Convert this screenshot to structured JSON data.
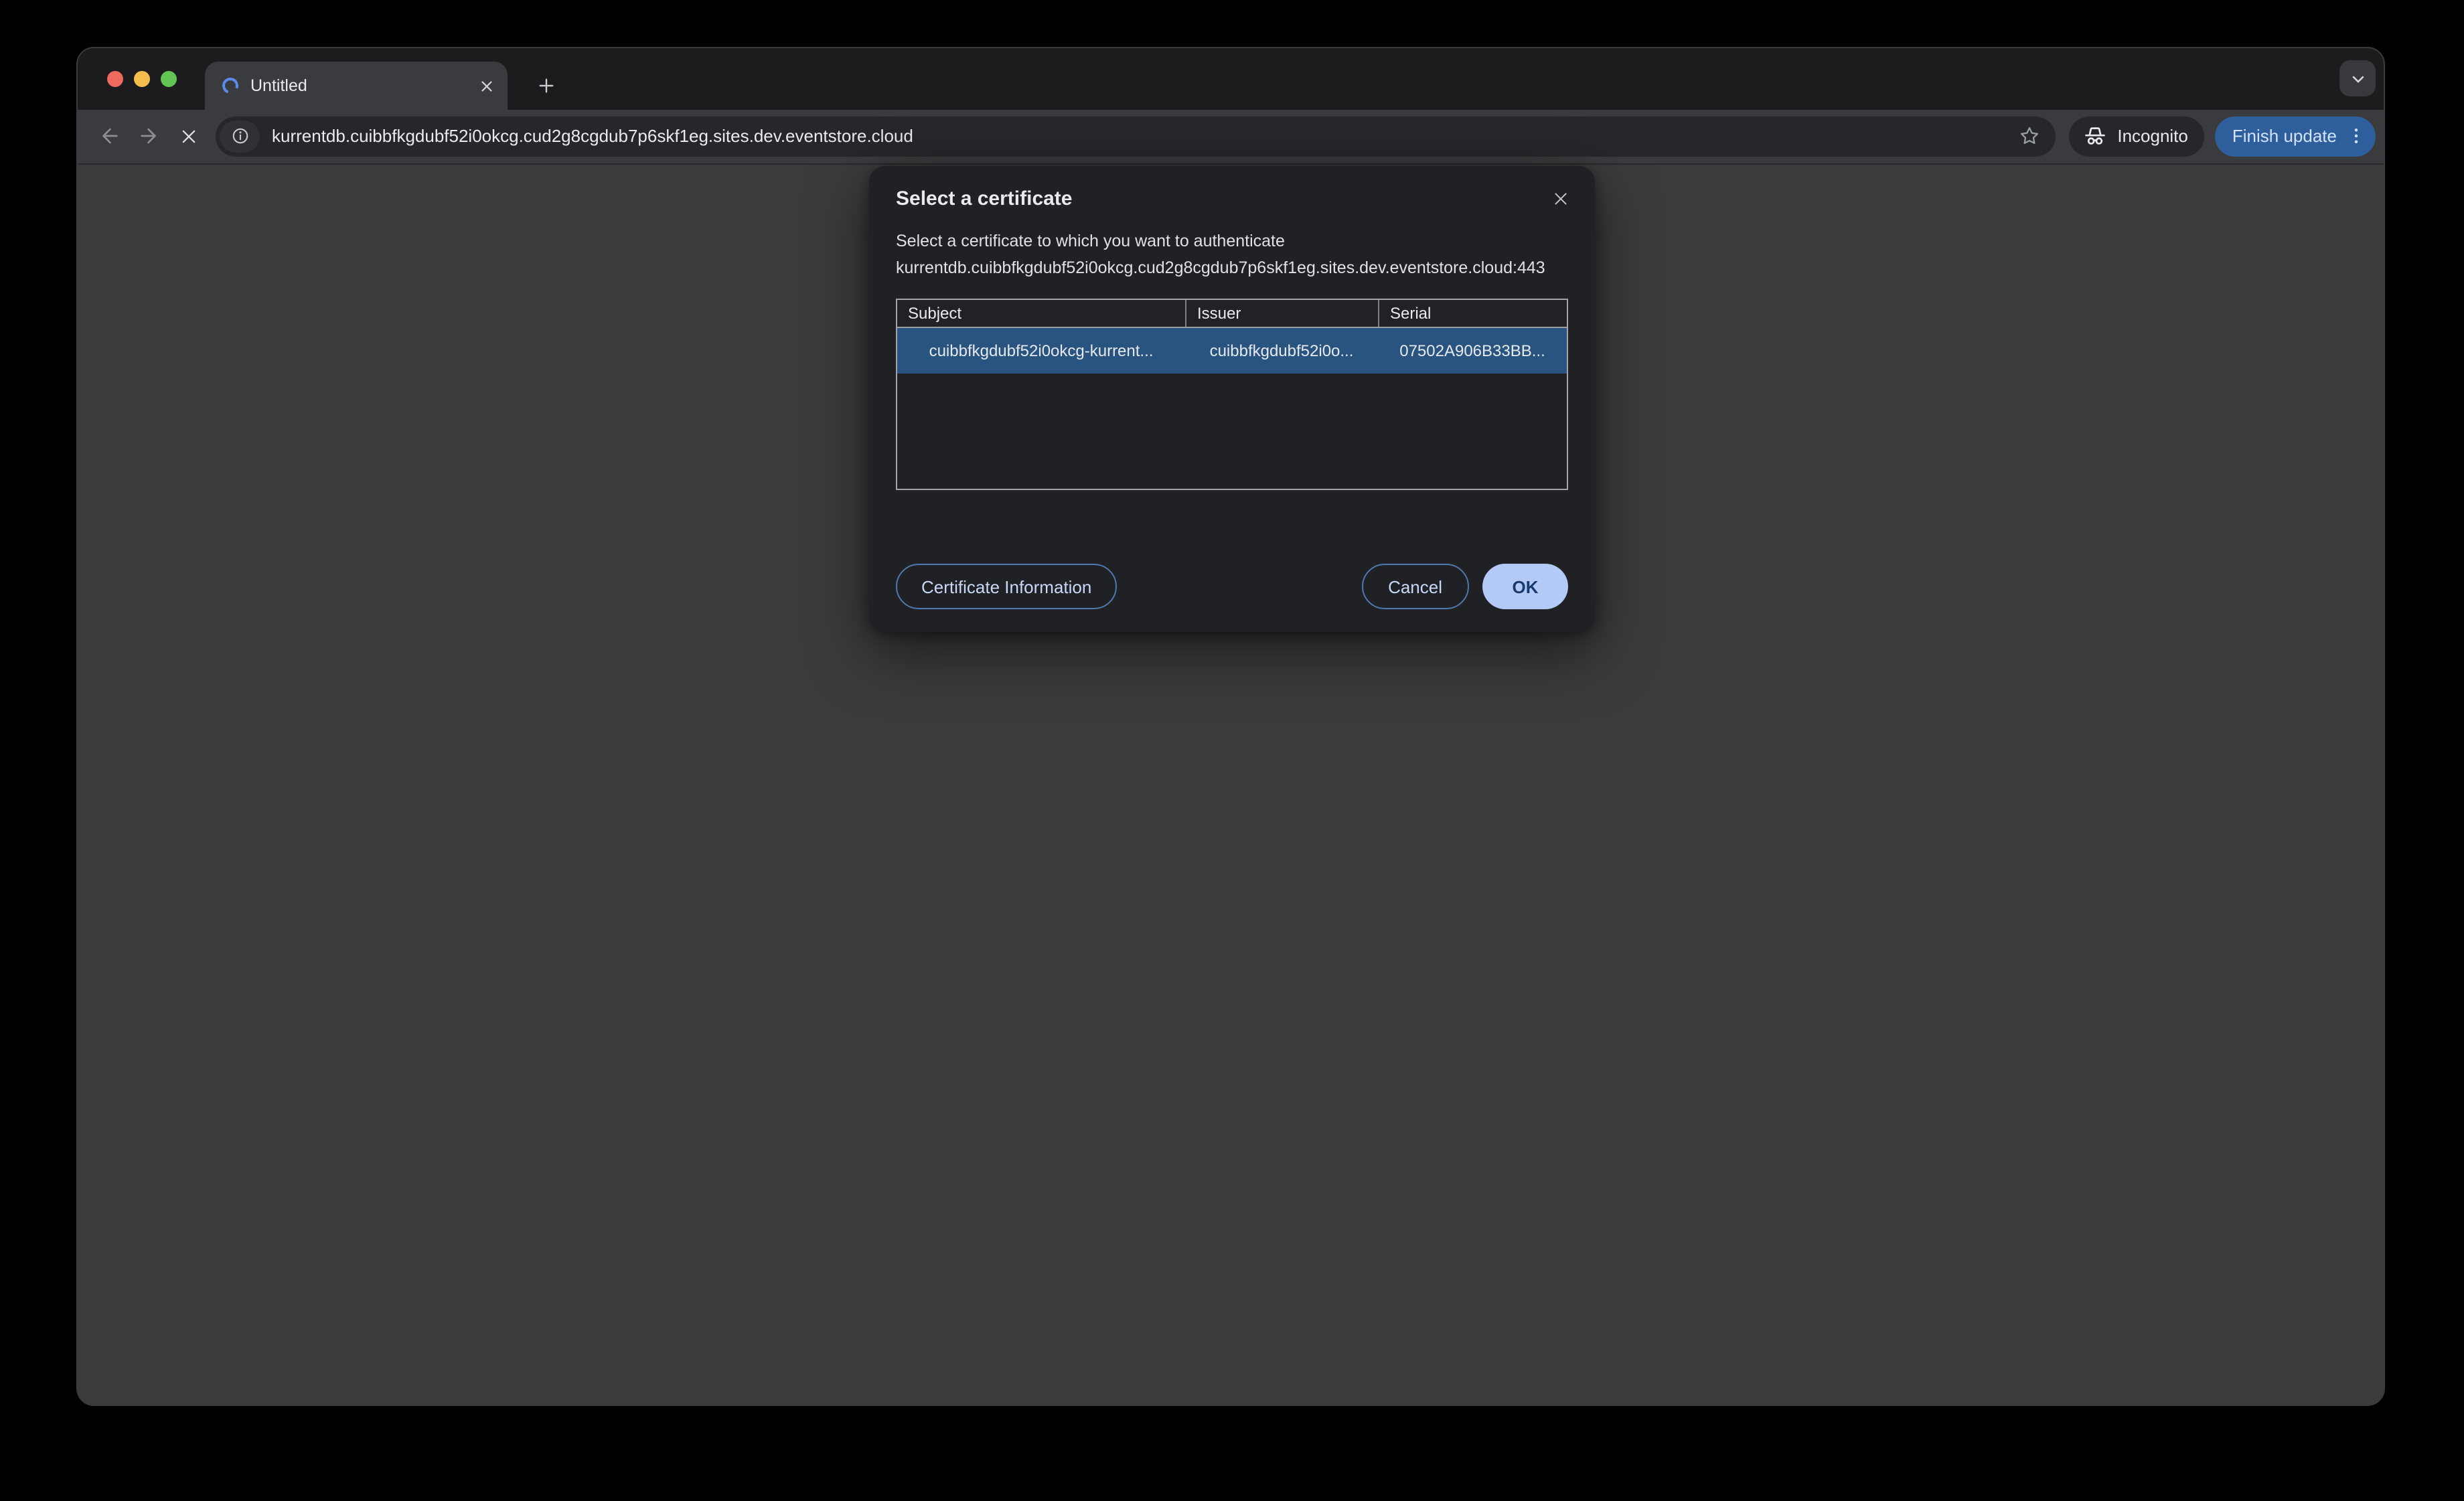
{
  "colors": {
    "traffic_red": "#ee6a5f",
    "traffic_yellow": "#f5bd4c",
    "traffic_green": "#61c455",
    "spinner_blue": "#5b8bf0",
    "selected_row_bg": "#29547f",
    "update_button_bg": "#2e5e9b",
    "ok_button_bg": "#b4caf6",
    "ok_button_text": "#173a70",
    "outline_button_border": "#4d79ad",
    "outline_button_text": "#c8d8f8",
    "dialog_bg": "#202124",
    "toolbar_bg": "#3a3b3e",
    "tabstrip_bg": "#1c1c1e"
  },
  "tabbar": {
    "tab_title": "Untitled"
  },
  "toolbar": {
    "url": "kurrentdb.cuibbfkgdubf52i0okcg.cud2g8cgdub7p6skf1eg.sites.dev.eventstore.cloud",
    "incognito_label": "Incognito",
    "update_button_label": "Finish update"
  },
  "dialog": {
    "title": "Select a certificate",
    "message": "Select a certificate to which you want to authenticate kurrentdb.cuibbfkgdubf52i0okcg.cud2g8cgdub7p6skf1eg.sites.dev.eventstore.cloud:443",
    "table": {
      "columns": [
        "Subject",
        "Issuer",
        "Serial"
      ],
      "rows": [
        {
          "subject": "cuibbfkgdubf52i0okcg-kurrent...",
          "issuer": "cuibbfkgdubf52i0o...",
          "serial": "07502A906B33BB..."
        }
      ]
    },
    "buttons": {
      "certificate_information": "Certificate Information",
      "cancel": "Cancel",
      "ok": "OK"
    }
  }
}
